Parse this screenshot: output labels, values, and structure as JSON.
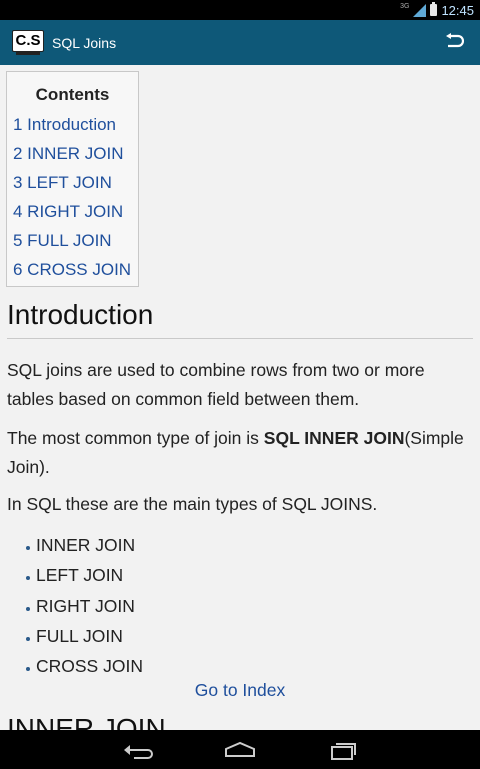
{
  "status_bar": {
    "network_label": "3G",
    "time": "12:45"
  },
  "action_bar": {
    "app_icon_text": "C.S",
    "title": "SQL Joins"
  },
  "toc": {
    "title": "Contents",
    "items": [
      "1 Introduction",
      "2 INNER JOIN",
      "3 LEFT JOIN",
      "4 RIGHT JOIN",
      "5 FULL JOIN",
      "6 CROSS JOIN"
    ]
  },
  "section": {
    "heading": "Introduction",
    "paragraph1": "SQL joins are used to combine rows from two or more tables based on common field between them.",
    "paragraph2_prefix": "The most common type of join is ",
    "paragraph2_bold": "SQL INNER JOIN",
    "paragraph2_suffix": "(Simple Join).",
    "paragraph3": "In SQL these are the main types of SQL JOINS.",
    "bullets": [
      "INNER JOIN",
      "LEFT JOIN",
      "RIGHT JOIN",
      "FULL JOIN",
      "CROSS JOIN"
    ],
    "go_to_index": "Go to Index",
    "next_heading": "INNER JOIN"
  },
  "nav_bar": {
    "icons": [
      "back-icon",
      "home-icon",
      "recent-apps-icon"
    ]
  },
  "colors": {
    "action_bar": "#0e5878",
    "link": "#1f4f9c",
    "background": "#f2f2f2"
  }
}
